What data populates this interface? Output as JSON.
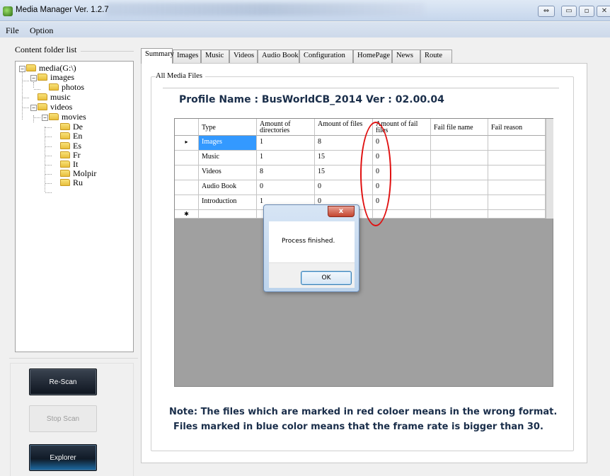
{
  "window": {
    "title": "Media Manager Ver. 1.2.7",
    "btn_restore": "⇔",
    "btn_min": "▭",
    "btn_max": "▫",
    "btn_close": "✕"
  },
  "menu": {
    "file": "File",
    "option": "Option"
  },
  "left": {
    "folder_list_label": "Content folder list",
    "tree": {
      "root": "media(G:\\)",
      "images": "images",
      "photos": "photos",
      "music": "music",
      "videos": "videos",
      "movies": "movies",
      "de": "De",
      "en": "En",
      "es": "Es",
      "fr": "Fr",
      "it": "It",
      "molpir": "Molpir",
      "ru": "Ru"
    },
    "buttons": {
      "rescan": "Re-Scan",
      "stopscan": "Stop Scan",
      "explorer": "Explorer"
    }
  },
  "tabs": [
    "Summary",
    "Images",
    "Music",
    "Videos",
    "Audio Book",
    "Configuration",
    "HomePage",
    "News",
    "Route"
  ],
  "summary": {
    "group_label": "All Media Files",
    "profile": "Profile Name : BusWorldCB_2014   Ver : 02.00.04",
    "columns": [
      "Type",
      "Amount of directories",
      "Amount of files",
      "Amount of fail files",
      "Fail file name",
      "Fail reason"
    ],
    "rows": [
      [
        "Images",
        "1",
        "8",
        "0",
        "",
        ""
      ],
      [
        "Music",
        "1",
        "15",
        "0",
        "",
        ""
      ],
      [
        "Videos",
        "8",
        "15",
        "0",
        "",
        ""
      ],
      [
        "Audio Book",
        "0",
        "0",
        "0",
        "",
        ""
      ],
      [
        "Introduction",
        "1",
        "0",
        "0",
        "",
        ""
      ]
    ],
    "current_row_marker": "▸",
    "new_row_marker": "✱",
    "note1": "Note: The files which are marked in red coloer means in the wrong format.",
    "note2": "Files marked in blue color means that the frame rate is bigger than 30."
  },
  "dialog": {
    "close": "x",
    "message": "Process finished.",
    "ok": "OK"
  },
  "colors": {
    "annotation": "#e01010",
    "selection": "#3399ff",
    "note_text": "#1a2e4a"
  }
}
